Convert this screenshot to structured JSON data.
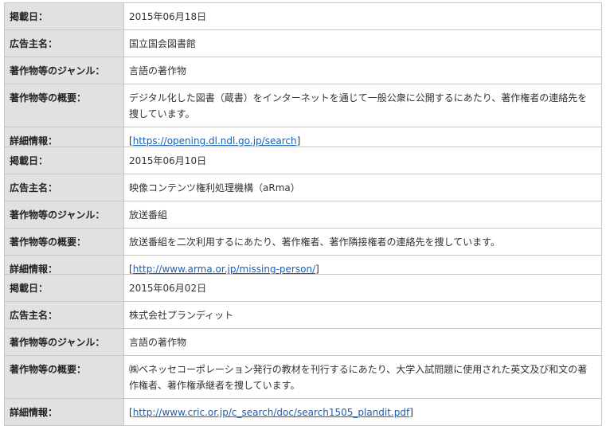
{
  "labels": {
    "date": "掲載日：",
    "advertiser": "広告主名：",
    "genre": "著作物等のジャンル：",
    "summary": "著作物等の概要：",
    "details": "詳細情報："
  },
  "entries": [
    {
      "date": "2015年06月18日",
      "advertiser": "国立国会図書館",
      "genre": "言語の著作物",
      "summary": "デジタル化した図書（蔵書）をインターネットを通じて一般公衆に公開するにあたり、著作権者の連絡先を捜しています。",
      "details_url": "https://opening.dl.ndl.go.jp/search"
    },
    {
      "date": "2015年06月10日",
      "advertiser": "映像コンテンツ権利処理機構（aRma）",
      "genre": "放送番組",
      "summary": "放送番組を二次利用するにあたり、著作権者、著作隣接権者の連絡先を捜しています。",
      "details_url": "http://www.arma.or.jp/missing-person/"
    },
    {
      "date": "2015年06月02日",
      "advertiser": "株式会社プランディット",
      "genre": "言語の著作物",
      "summary": "㈱ベネッセコーポレーション発行の教材を刊行するにあたり、大学入試問題に使用された英文及び和文の著作権者、著作権承継者を捜しています。",
      "details_url": "http://www.cric.or.jp/c_search/doc/search1505_plandit.pdf"
    }
  ]
}
